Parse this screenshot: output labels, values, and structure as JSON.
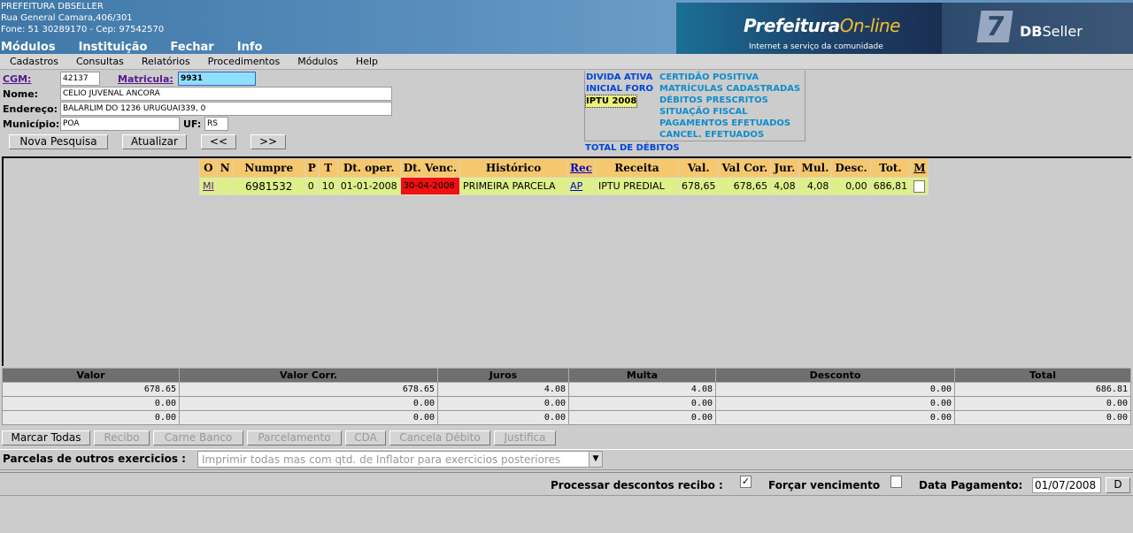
{
  "header": {
    "org_name": "PREFEITURA DBSELLER",
    "address": "Rua General Camara,406/301",
    "phone": "Fone: 51 30289170  -  Cep: 97542570",
    "menu": [
      "Módulos",
      "Instituição",
      "Fechar",
      "Info"
    ],
    "banner": {
      "title_a": "Prefeitura",
      "title_b": "On-line",
      "subtitle": "Internet a serviço da comunidade",
      "brand_a": "DB",
      "brand_b": "Seller"
    }
  },
  "menubar": [
    "Cadastros",
    "Consultas",
    "Relatórios",
    "Procedimentos",
    "Módulos",
    "Help"
  ],
  "form": {
    "cgm_label": "CGM:",
    "cgm_value": "42137",
    "matricula_label": "Matricula:",
    "matricula_value": "9931",
    "nome_label": "Nome:",
    "nome_value": "CELIO JUVENAL ANCORA",
    "endereco_label": "Endereço:",
    "endereco_value": "BALARLIM DO 1236 URUGUAI339, 0",
    "municipio_label": "Município:",
    "municipio_value": "POA",
    "uf_label": "UF:",
    "uf_value": "RS",
    "btn_nova": "Nova Pesquisa",
    "btn_atualizar": "Atualizar",
    "btn_prev": "<<",
    "btn_next": ">>"
  },
  "debt_links": {
    "left": [
      "DIVIDA ATIVA",
      "INICIAL FORO",
      "IPTU 2008"
    ],
    "right": [
      "CERTIDÃO POSITIVA",
      "MATRÍCULAS CADASTRADAS",
      "DÉBITOS PRESCRITOS",
      "SITUAÇÃO FISCAL",
      "PAGAMENTOS EFETUADOS",
      "CANCEL. EFETUADOS"
    ],
    "total": "TOTAL DE DÉBITOS"
  },
  "debt_table": {
    "headers": [
      "O",
      "N",
      "Numpre",
      "P",
      "T",
      "Dt. oper.",
      "Dt. Venc.",
      "Histórico",
      "Rec",
      "Receita",
      "Val.",
      "Val Cor.",
      "Jur.",
      "Mul.",
      "Desc.",
      "Tot.",
      "M"
    ],
    "rows": [
      [
        "MI",
        "",
        "6981532",
        "0",
        "10",
        "01-01-2008",
        "30-04-2008",
        "PRIMEIRA PARCELA",
        "AP",
        "IPTU PREDIAL",
        "678,65",
        "678,65",
        "4,08",
        "4,08",
        "0,00",
        "686,81",
        ""
      ]
    ]
  },
  "summary": {
    "headers": [
      "Valor",
      "Valor Corr.",
      "Juros",
      "Multa",
      "Desconto",
      "Total"
    ],
    "rows": [
      [
        "678.65",
        "678.65",
        "4.08",
        "4.08",
        "0.00",
        "686.81"
      ],
      [
        "0.00",
        "0.00",
        "0.00",
        "0.00",
        "0.00",
        "0.00"
      ],
      [
        "0.00",
        "0.00",
        "0.00",
        "0.00",
        "0.00",
        "0.00"
      ]
    ]
  },
  "actions": [
    "Marcar Todas",
    "Recibo",
    "Carne Banco",
    "Parcelamento",
    "CDA",
    "Cancela Débito",
    "Justifica"
  ],
  "parcelas": {
    "label": "Parcelas de outros exercicios :",
    "selected": "Imprimir todas mas com qtd. de Inflator para exercicios posteriores"
  },
  "bottom": {
    "processar_label": "Processar descontos recibo :",
    "processar_checked": "✓",
    "forcar_label": "Forçar vencimento",
    "data_label": "Data Pagamento:",
    "data_value": "01/07/2008",
    "d_button": "D"
  },
  "colors": {
    "header_bg": "#5a8fbd",
    "table_header": "#f5c870",
    "table_row": "#ddf08a",
    "overdue": "#ee1111",
    "link_blue": "#0044dd"
  }
}
